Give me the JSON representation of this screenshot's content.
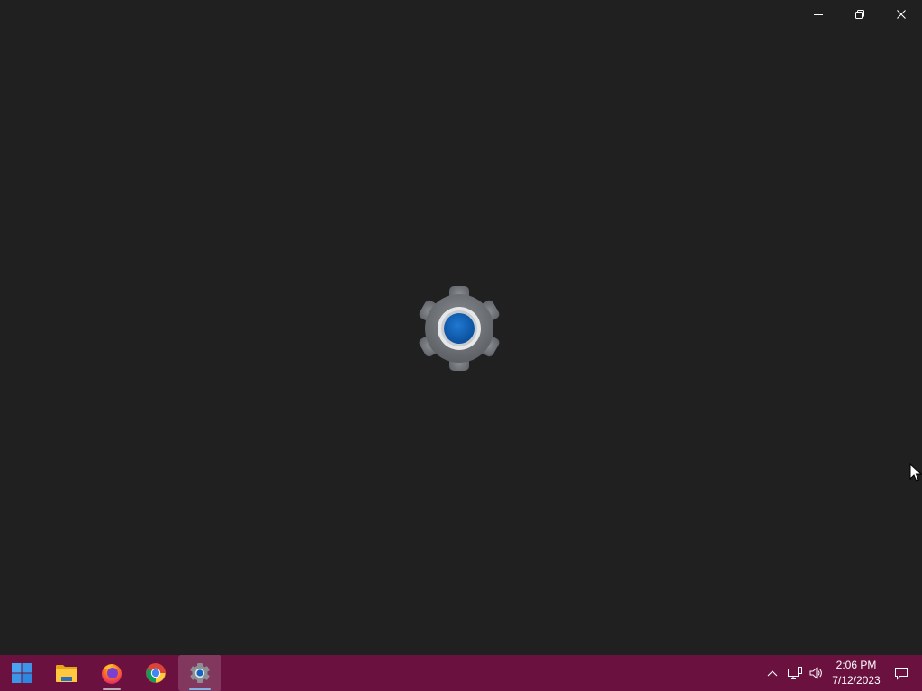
{
  "window": {
    "caption_buttons": {
      "minimize": "minimize-icon",
      "restore": "restore-icon",
      "close": "close-icon"
    },
    "splash_icon": "settings-gear-icon",
    "background_color": "#202020"
  },
  "taskbar": {
    "background_color": "#6b1140",
    "apps": [
      {
        "name": "Start",
        "icon": "windows-start-icon",
        "active": false
      },
      {
        "name": "File Explorer",
        "icon": "folder-icon",
        "active": false
      },
      {
        "name": "Firefox",
        "icon": "firefox-icon",
        "active": false,
        "running": true
      },
      {
        "name": "Chrome",
        "icon": "chrome-icon",
        "active": false
      },
      {
        "name": "Settings",
        "icon": "settings-gear-icon",
        "active": true,
        "running": true
      }
    ],
    "tray": {
      "icons": [
        "chevron-up-icon",
        "network-icon",
        "volume-icon",
        "notification-icon"
      ],
      "time": "2:06 PM",
      "date": "7/12/2023"
    }
  }
}
